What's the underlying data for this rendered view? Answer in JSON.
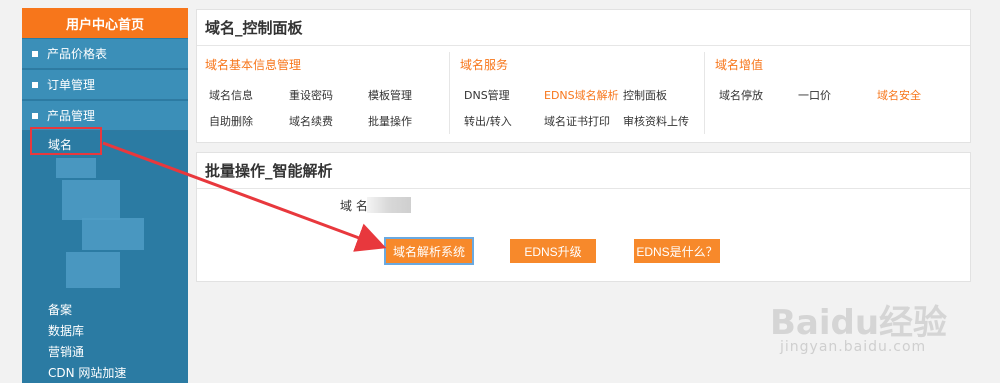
{
  "sidebar": {
    "home": "用户中心首页",
    "items": [
      {
        "label": "产品价格表"
      },
      {
        "label": "订单管理"
      },
      {
        "label": "产品管理"
      }
    ],
    "sub_domain": "域名",
    "bottom_items": [
      "备案",
      "数据库",
      "营销通",
      "CDN 网站加速"
    ]
  },
  "control_panel": {
    "title": "域名_控制面板",
    "groups": [
      {
        "title": "域名基本信息管理",
        "links": [
          "域名信息",
          "重设密码",
          "模板管理",
          "自助删除",
          "域名续费",
          "批量操作"
        ]
      },
      {
        "title": "域名服务",
        "links": [
          "DNS管理",
          "EDNS域名解析",
          "控制面板",
          "转出/转入",
          "域名证书打印",
          "审核资料上传"
        ]
      },
      {
        "title": "域名增值",
        "links": [
          "域名停放",
          "一口价",
          "域名安全"
        ]
      }
    ]
  },
  "batch_panel": {
    "title": "批量操作_智能解析",
    "domain_label": "域  名",
    "buttons": [
      "域名解析系统",
      "EDNS升级",
      "EDNS是什么？"
    ]
  },
  "watermark": {
    "logo": "Baidu经验",
    "sub": "jingyan.baidu.com"
  },
  "colors": {
    "accent": "#f7761b",
    "sidebar": "#2b7ba3",
    "annotation": "#e8383d"
  }
}
